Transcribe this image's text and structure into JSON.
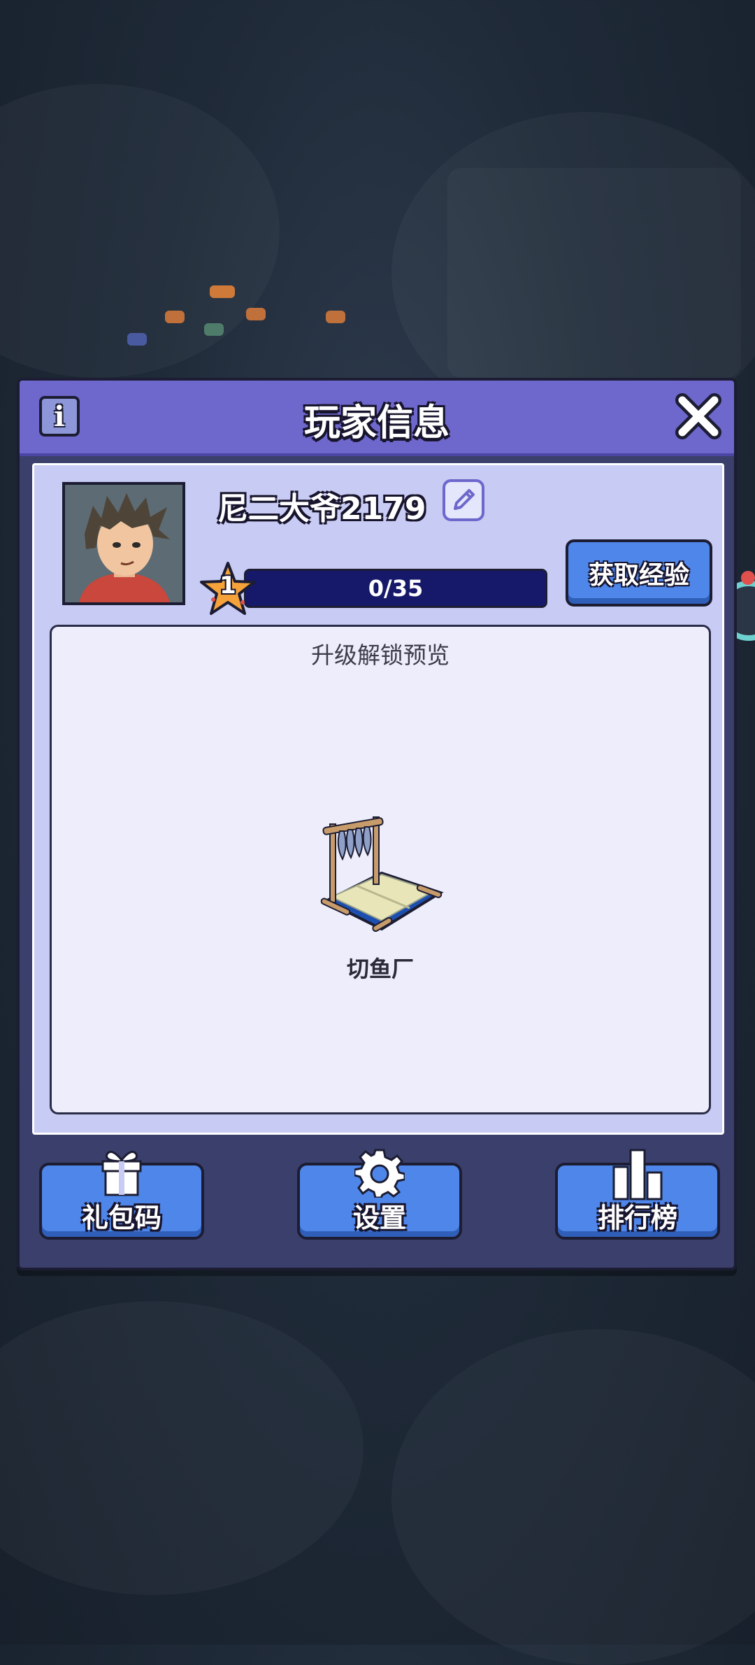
{
  "dialog": {
    "title": "玩家信息",
    "info_icon": "info-icon",
    "close_icon": "close-icon"
  },
  "player": {
    "name": "尼二大爷2179",
    "avatar_icon": "player-avatar",
    "edit_icon": "pencil-icon",
    "level": "1",
    "exp_text": "0/35",
    "exp_progress": 0,
    "get_exp_label": "获取经验"
  },
  "unlock_preview": {
    "title": "升级解锁预览",
    "building_name": "切鱼厂",
    "building_icon": "fish-cutting-station"
  },
  "bottom_buttons": [
    {
      "label": "礼包码",
      "icon": "gift-icon"
    },
    {
      "label": "设置",
      "icon": "gear-icon"
    },
    {
      "label": "排行榜",
      "icon": "bar-chart-icon"
    }
  ],
  "colors": {
    "header": "#6e67cc",
    "button_blue": "#4f86ea",
    "panel": "#c8cbf3",
    "dialog_bg": "#3b3f6c"
  }
}
